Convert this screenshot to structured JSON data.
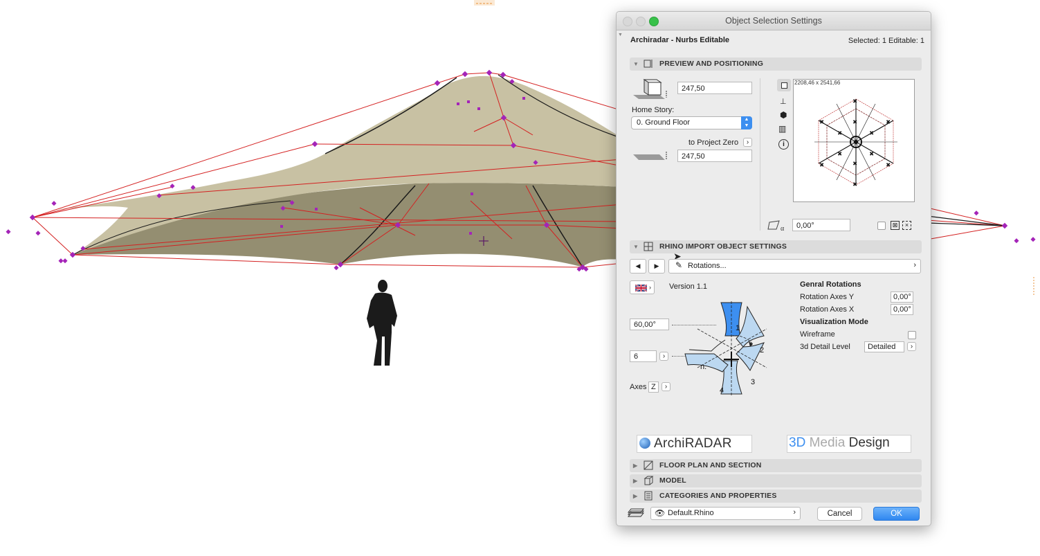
{
  "dialog": {
    "title": "Object Selection Settings",
    "object_name": "Archiradar - Nurbs Editable",
    "selection_info": "Selected: 1 Editable: 1"
  },
  "sections": {
    "preview": "PREVIEW AND POSITIONING",
    "rhino": "RHINO IMPORT OBJECT SETTINGS",
    "floorplan": "FLOOR PLAN AND SECTION",
    "model": "MODEL",
    "categories": "CATEGORIES AND PROPERTIES"
  },
  "positioning": {
    "height_value": "247,50",
    "home_story_label": "Home Story:",
    "home_story_value": "0. Ground Floor",
    "to_project_zero_label": "to Project Zero",
    "elevation_value": "247,50",
    "preview_dimensions": "2208,46 x 2541,66",
    "angle_value": "0,00°"
  },
  "rhino": {
    "nav_dropdown": "Rotations...",
    "version": "Version 1.1",
    "angle_input": "60,00°",
    "count_input": "6",
    "axes_label": "Axes",
    "axes_value": "Z",
    "diagram_labels": [
      "1",
      "2",
      "3",
      "4",
      "n."
    ],
    "general_rotations_title": "Genral Rotations",
    "rotation_y_label": "Rotation Axes Y",
    "rotation_y_value": "0,00°",
    "rotation_x_label": "Rotation Axes X",
    "rotation_x_value": "0,00°",
    "visualization_title": "Visualization Mode",
    "wireframe_label": "Wireframe",
    "wireframe_checked": false,
    "detail_label": "3d Detail Level",
    "detail_value": "Detailed"
  },
  "logos": {
    "archiradar": "ArchiRADAR",
    "media_design_prefix": "3D",
    "media_design_mid": " Media ",
    "media_design_suffix": "Design"
  },
  "footer": {
    "layer_value": "Default.Rhino",
    "cancel": "Cancel",
    "ok": "OK"
  },
  "colors": {
    "accent_blue": "#3d8ff0",
    "canopy_top": "#c9c2a4",
    "canopy_under": "#958f72",
    "control_point": "#a424b8",
    "wire_red": "#d42020"
  }
}
